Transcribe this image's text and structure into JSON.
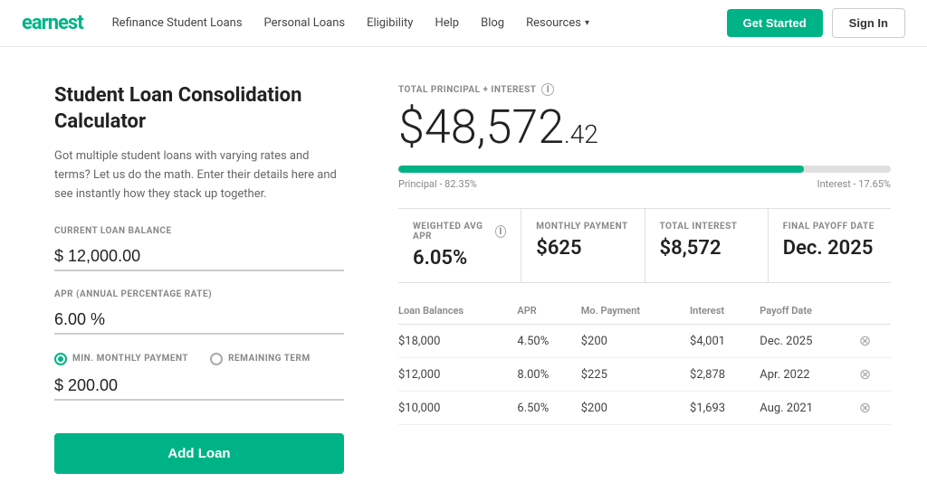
{
  "logo": "earnest",
  "nav": {
    "links": [
      {
        "label": "Refinance Student Loans"
      },
      {
        "label": "Personal Loans"
      },
      {
        "label": "Eligibility"
      },
      {
        "label": "Help"
      },
      {
        "label": "Blog"
      },
      {
        "label": "Resources",
        "hasChevron": true
      }
    ],
    "get_started": "Get Started",
    "sign_in": "Sign In"
  },
  "left": {
    "title": "Student Loan Consolidation Calculator",
    "desc": "Got multiple student loans with varying rates and terms? Let us do the math. Enter their details here and see instantly how they stack up together.",
    "balance_label": "CURRENT LOAN BALANCE",
    "balance_value": "$ 12,000.00",
    "apr_label": "APR (ANNUAL PERCENTAGE RATE)",
    "apr_value": "6.00 %",
    "mode_min": "MIN. MONTHLY PAYMENT",
    "mode_remaining": "REMAINING TERM",
    "payment_label": "",
    "payment_value": "$ 200.00",
    "add_loan": "Add Loan"
  },
  "right": {
    "total_label": "TOTAL PRINCIPAL + INTEREST",
    "total_main": "$48,572",
    "total_cents": ".42",
    "progress_pct": 82.35,
    "principal_label": "Principal - 82.35%",
    "interest_label": "Interest - 17.65%",
    "stats": [
      {
        "label": "WEIGHTED AVG APR",
        "value": "6.05%",
        "has_info": true
      },
      {
        "label": "MONTHLY PAYMENT",
        "value": "$625"
      },
      {
        "label": "TOTAL INTEREST",
        "value": "$8,572"
      },
      {
        "label": "FINAL PAYOFF DATE",
        "value": "Dec. 2025"
      }
    ],
    "table_headers": [
      "Loan Balances",
      "APR",
      "Mo. Payment",
      "Interest",
      "Payoff Date",
      ""
    ],
    "table_rows": [
      {
        "balance": "$18,000",
        "apr": "4.50%",
        "payment": "$200",
        "interest": "$4,001",
        "payoff": "Dec. 2025"
      },
      {
        "balance": "$12,000",
        "apr": "8.00%",
        "payment": "$225",
        "interest": "$2,878",
        "payoff": "Apr. 2022"
      },
      {
        "balance": "$10,000",
        "apr": "6.50%",
        "payment": "$200",
        "interest": "$1,693",
        "payoff": "Aug. 2021"
      }
    ]
  }
}
